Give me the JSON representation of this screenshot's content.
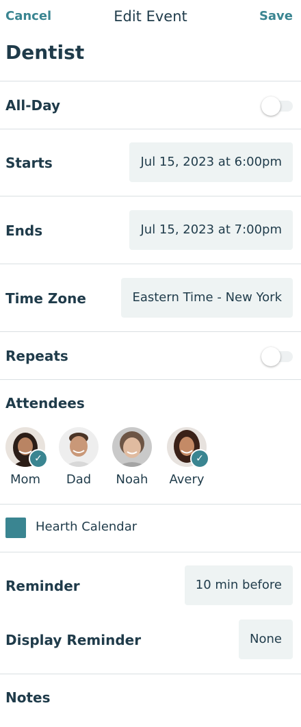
{
  "header": {
    "cancel_label": "Cancel",
    "title": "Edit Event",
    "save_label": "Save"
  },
  "event": {
    "title": "Dentist"
  },
  "all_day": {
    "label": "All-Day",
    "on": false
  },
  "starts": {
    "label": "Starts",
    "value": "Jul 15, 2023 at 6:00pm"
  },
  "ends": {
    "label": "Ends",
    "value": "Jul 15, 2023 at 7:00pm"
  },
  "time_zone": {
    "label": "Time Zone",
    "value": "Eastern Time - New York"
  },
  "repeats": {
    "label": "Repeats",
    "on": false
  },
  "attendees": {
    "label": "Attendees",
    "people": [
      {
        "name": "Mom",
        "selected": true
      },
      {
        "name": "Dad",
        "selected": false
      },
      {
        "name": "Noah",
        "selected": false
      },
      {
        "name": "Avery",
        "selected": true
      }
    ]
  },
  "calendar": {
    "name": "Hearth Calendar",
    "color": "#3a8591"
  },
  "reminder": {
    "label": "Reminder",
    "value": "10 min before"
  },
  "display_reminder": {
    "label": "Display Reminder",
    "value": "None"
  },
  "notes": {
    "label": "Notes"
  },
  "colors": {
    "accent": "#3a8591",
    "text": "#1f3b4a",
    "pill_bg": "#eef3f3"
  }
}
